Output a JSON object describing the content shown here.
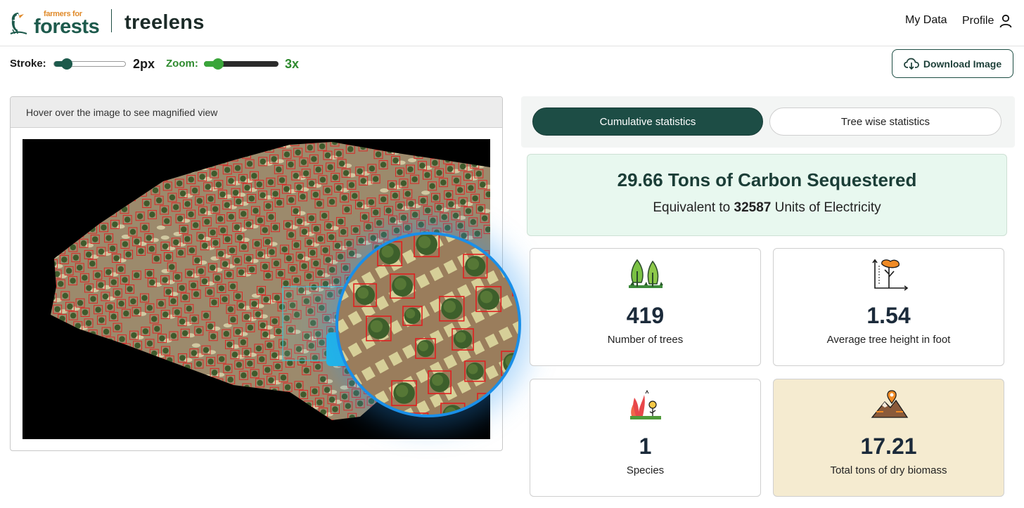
{
  "header": {
    "brand_small": "farmers for",
    "brand_big": "forests",
    "product": "treelens",
    "nav": {
      "my_data": "My Data",
      "profile": "Profile"
    }
  },
  "toolbar": {
    "stroke_label": "Stroke:",
    "stroke_value": "2px",
    "zoom_label": "Zoom:",
    "zoom_value": "3x",
    "download_label": "Download Image"
  },
  "viewer": {
    "hint": "Hover over the image to see magnified view"
  },
  "tabs": [
    {
      "label": "Cumulative statistics",
      "active": true
    },
    {
      "label": "Tree wise statistics",
      "active": false
    }
  ],
  "carbon": {
    "title": "29.66 Tons of Carbon Sequestered",
    "sub_prefix": "Equivalent to ",
    "sub_value": "32587",
    "sub_suffix": " Units of Electricity"
  },
  "stats": [
    {
      "icon": "trees-icon",
      "value": "419",
      "label": "Number of trees"
    },
    {
      "icon": "tree-height-icon",
      "value": "1.54",
      "label": "Average tree height in foot"
    },
    {
      "icon": "species-icon",
      "value": "1",
      "label": "Species"
    },
    {
      "icon": "biomass-icon",
      "value": "17.21",
      "label": "Total tons of dry biomass"
    }
  ],
  "colors": {
    "brand_green": "#1d5a4c",
    "brand_orange": "#e08a2a",
    "active_tab": "#1d4d45",
    "carbon_bg": "#e8f8ef",
    "biomass_bg": "#f5ebd0",
    "magnifier_border": "#1a8fe8",
    "tree_box": "#e02020"
  }
}
